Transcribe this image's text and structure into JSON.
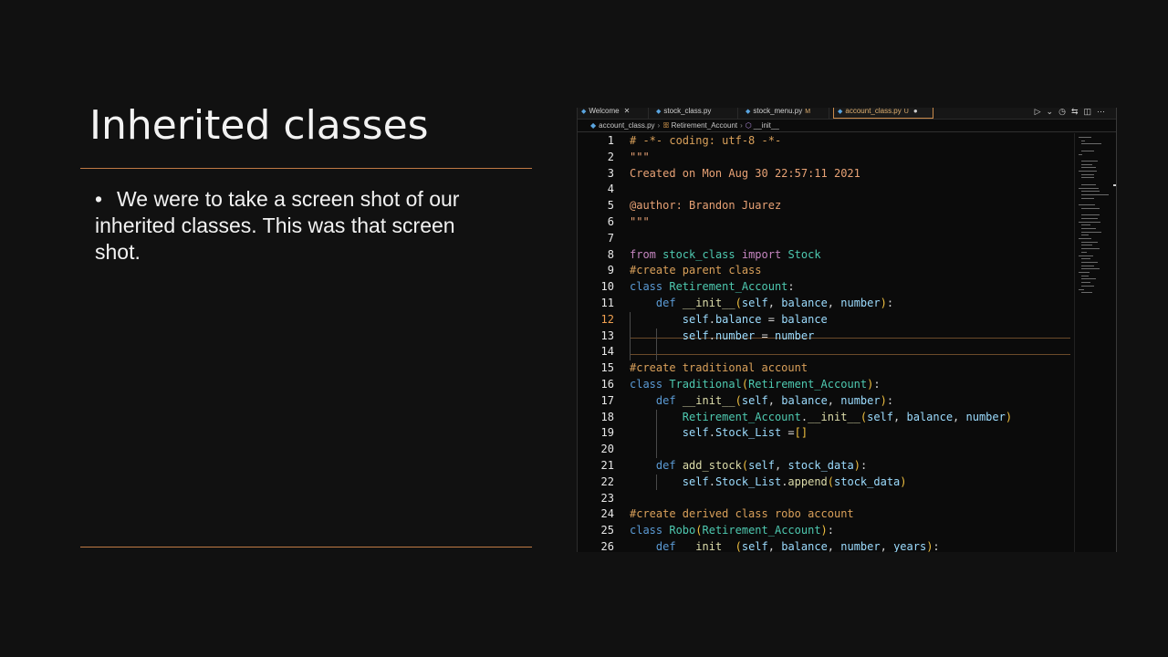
{
  "slide": {
    "title": "Inherited classes",
    "bullets": [
      "We were to take a screen shot of our inherited classes. This was that screen shot."
    ]
  },
  "editor": {
    "tabs": [
      {
        "label": "Welcome",
        "close": "✕"
      },
      {
        "label": "stock_class.py"
      },
      {
        "label": "stock_menu.py",
        "status": "M"
      },
      {
        "label": "account_class.py",
        "status": "U",
        "dot": "●"
      }
    ],
    "breadcrumb": [
      "account_class.py",
      "Retirement_Account",
      "__init__"
    ],
    "code": [
      {
        "n": "1",
        "t": "# -*- coding: utf-8 -*-"
      },
      {
        "n": "2",
        "t": "\"\"\""
      },
      {
        "n": "3",
        "t": "Created on Mon Aug 30 22:57:11 2021"
      },
      {
        "n": "4",
        "t": ""
      },
      {
        "n": "5",
        "t": "@author: Brandon Juarez"
      },
      {
        "n": "6",
        "t": "\"\"\""
      },
      {
        "n": "7",
        "t": ""
      },
      {
        "n": "8",
        "t": "from stock_class import Stock"
      },
      {
        "n": "9",
        "t": "#create parent class"
      },
      {
        "n": "10",
        "t": "class Retirement_Account:"
      },
      {
        "n": "11",
        "t": "    def __init__(self, balance, number):"
      },
      {
        "n": "12",
        "t": "        self.balance = balance"
      },
      {
        "n": "13",
        "t": "        self.number = number"
      },
      {
        "n": "14",
        "t": ""
      },
      {
        "n": "15",
        "t": "#create traditional account"
      },
      {
        "n": "16",
        "t": "class Traditional(Retirement_Account):"
      },
      {
        "n": "17",
        "t": "    def __init__(self, balance, number):"
      },
      {
        "n": "18",
        "t": "        Retirement_Account.__init__(self, balance, number)"
      },
      {
        "n": "19",
        "t": "        self.Stock_List =[]"
      },
      {
        "n": "20",
        "t": ""
      },
      {
        "n": "21",
        "t": "    def add_stock(self, stock_data):"
      },
      {
        "n": "22",
        "t": "        self.Stock_List.append(stock_data)"
      },
      {
        "n": "23",
        "t": ""
      },
      {
        "n": "24",
        "t": "#create derived class robo account"
      },
      {
        "n": "25",
        "t": "class Robo(Retirement_Account):"
      },
      {
        "n": "26",
        "t": "    def __init__(self, balance, number, years):"
      }
    ],
    "current_line": "12",
    "colors": {
      "comment": "#d9a05a",
      "keyword": "#5b9bd5",
      "class": "#4ec9b0",
      "function": "#dcdcaa",
      "variable": "#9cdcfe",
      "accent_rule": "#c07a45"
    }
  }
}
